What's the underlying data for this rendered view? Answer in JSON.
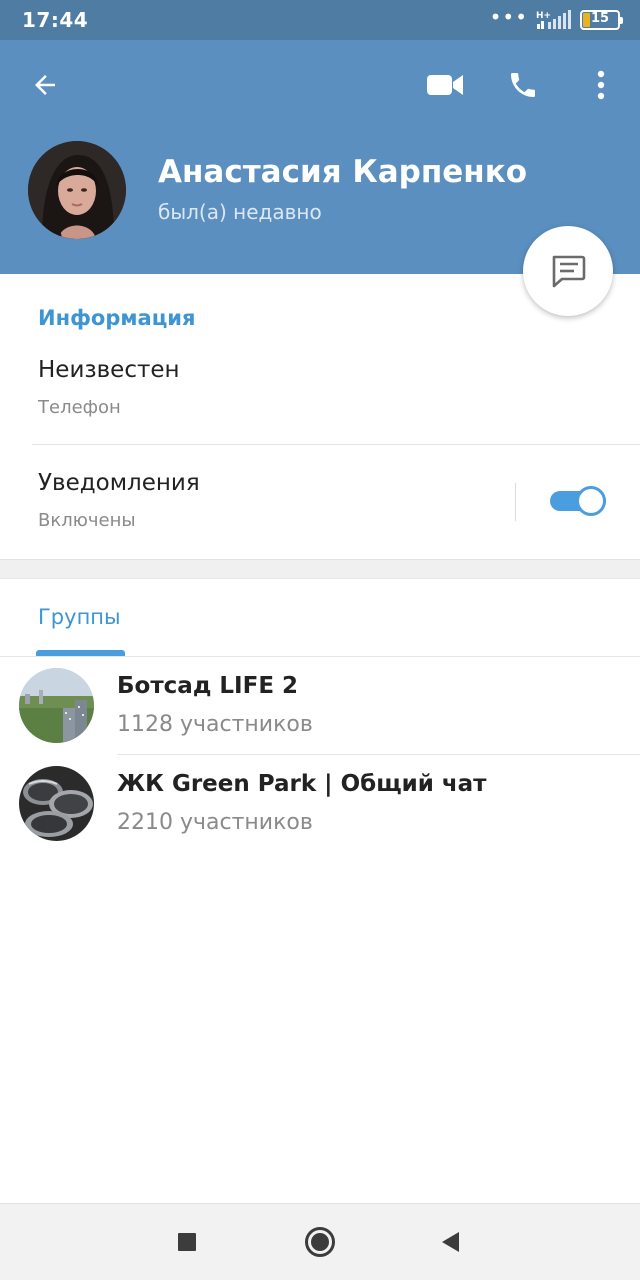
{
  "status_bar": {
    "time": "17:44",
    "network": "H+",
    "battery": "15",
    "dots": "•••"
  },
  "header": {
    "back_icon": "arrow-left-icon",
    "video_icon": "video-camera-icon",
    "call_icon": "phone-icon",
    "more_icon": "more-vertical-icon",
    "name": "Анастасия Карпенко",
    "status": "был(а) недавно",
    "color": "#5b8fc0"
  },
  "fab": {
    "icon": "message-icon"
  },
  "info": {
    "section_title": "Информация",
    "phone_value": "Неизвестен",
    "phone_label": "Телефон",
    "notifications_title": "Уведомления",
    "notifications_status": "Включены",
    "notifications_enabled": true
  },
  "groups": {
    "tab_label": "Группы",
    "items": [
      {
        "name": "Ботсад LIFE 2",
        "members": "1128 участников"
      },
      {
        "name": "ЖК Green Park | Общий чат",
        "members": "2210 участников"
      }
    ]
  },
  "nav": {
    "recents_icon": "square-icon",
    "home_icon": "circle-icon",
    "back_icon": "triangle-back-icon"
  },
  "accent_color": "#3d95d3"
}
